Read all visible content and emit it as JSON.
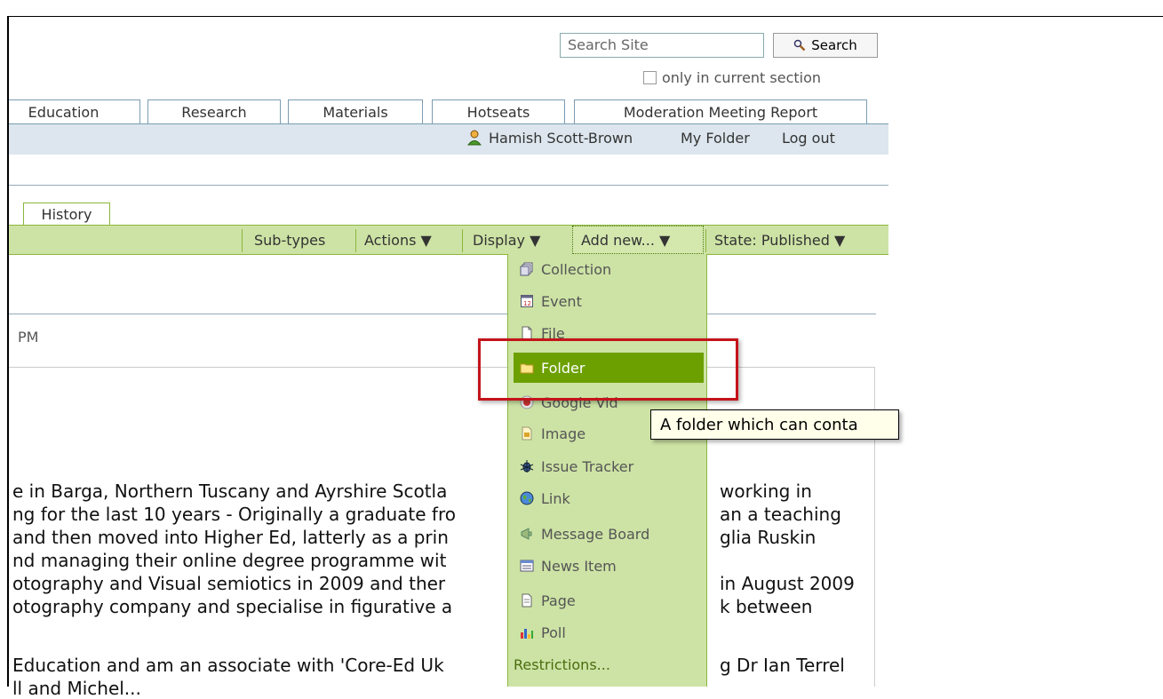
{
  "search": {
    "placeholder": "Search Site",
    "button_label": "Search",
    "only_current_label": "only in current section"
  },
  "main_tabs": [
    "Education",
    "Research",
    "Materials",
    "Hotseats",
    "Moderation Meeting Report"
  ],
  "personal_bar": {
    "user": "Hamish Scott-Brown",
    "my_folder": "My Folder",
    "logout": "Log out"
  },
  "history_tab": "History",
  "content_actions": {
    "subtypes": "Sub-types",
    "actions": "Actions ▼",
    "display": "Display ▼",
    "add_new": "Add new... ▼",
    "state": "State: Published ▼"
  },
  "byline_fragment": "PM",
  "add_menu": {
    "items": [
      {
        "label": "Collection",
        "icon": "collection-icon"
      },
      {
        "label": "Event",
        "icon": "event-icon"
      },
      {
        "label": "File",
        "icon": "file-icon"
      },
      {
        "label": "Folder",
        "icon": "folder-icon",
        "highlighted": true
      },
      {
        "label": "Google Vid",
        "icon": "google-video-icon"
      },
      {
        "label": "Image",
        "icon": "image-icon"
      },
      {
        "label": "Issue Tracker",
        "icon": "bug-icon"
      },
      {
        "label": "Link",
        "icon": "link-globe-icon"
      },
      {
        "label": "Message Board",
        "icon": "megaphone-icon"
      },
      {
        "label": "News Item",
        "icon": "news-icon"
      },
      {
        "label": "Page",
        "icon": "page-icon"
      },
      {
        "label": "Poll",
        "icon": "poll-icon"
      }
    ],
    "restrictions": "Restrictions..."
  },
  "tooltip": "A folder which can conta",
  "body_text": {
    "line1_left": "e in Barga, Northern Tuscany and Ayrshire Scotla",
    "line1_right": "working in",
    "line2_left": "ng for the last 10 years - Originally a graduate fro",
    "line2_right": "an a teaching",
    "line3_left": " and then moved into Higher Ed, latterly as a prin",
    "line3_right": "glia Ruskin",
    "line4_left": "nd managing their online degree programme wit",
    "line5_left": "otography and Visual semiotics in 2009 and ther",
    "line5_right": "in August 2009",
    "line6_left": "otography company and specialise in figurative a",
    "line6_right": "k between",
    "line7_left": " Education and am an associate with 'Core-Ed Uk",
    "line7_right": "g Dr Ian Terrel",
    "line8_left": "ll and Michel..."
  },
  "colors": {
    "green_bar": "#cde3a5",
    "highlight": "#6ca000",
    "personal_bar": "#dde6ee",
    "annotation_red": "#c4141a"
  }
}
